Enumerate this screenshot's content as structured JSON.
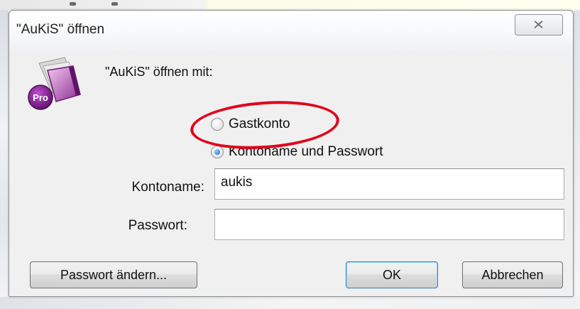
{
  "dialog": {
    "title": "\"AuKiS\" öffnen",
    "close_glyph": "✕",
    "logo_icon": "filemaker-pro-icon",
    "logo_text": "Pro",
    "prompt": "\"AuKiS\" öffnen mit:"
  },
  "options": [
    {
      "label": "Gastkonto",
      "selected": false
    },
    {
      "label": "Kontoname und Passwort",
      "selected": true
    }
  ],
  "fields": {
    "account_label": "Kontoname:",
    "account_value": "aukis",
    "password_label": "Passwort:",
    "password_value": ""
  },
  "buttons": {
    "change_password": "Passwort ändern...",
    "ok": "OK",
    "cancel": "Abbrechen"
  },
  "colors": {
    "annotation": "#e1001a",
    "logo_purple": "#7d1f86",
    "radio_selected": "#1c5fcf"
  }
}
